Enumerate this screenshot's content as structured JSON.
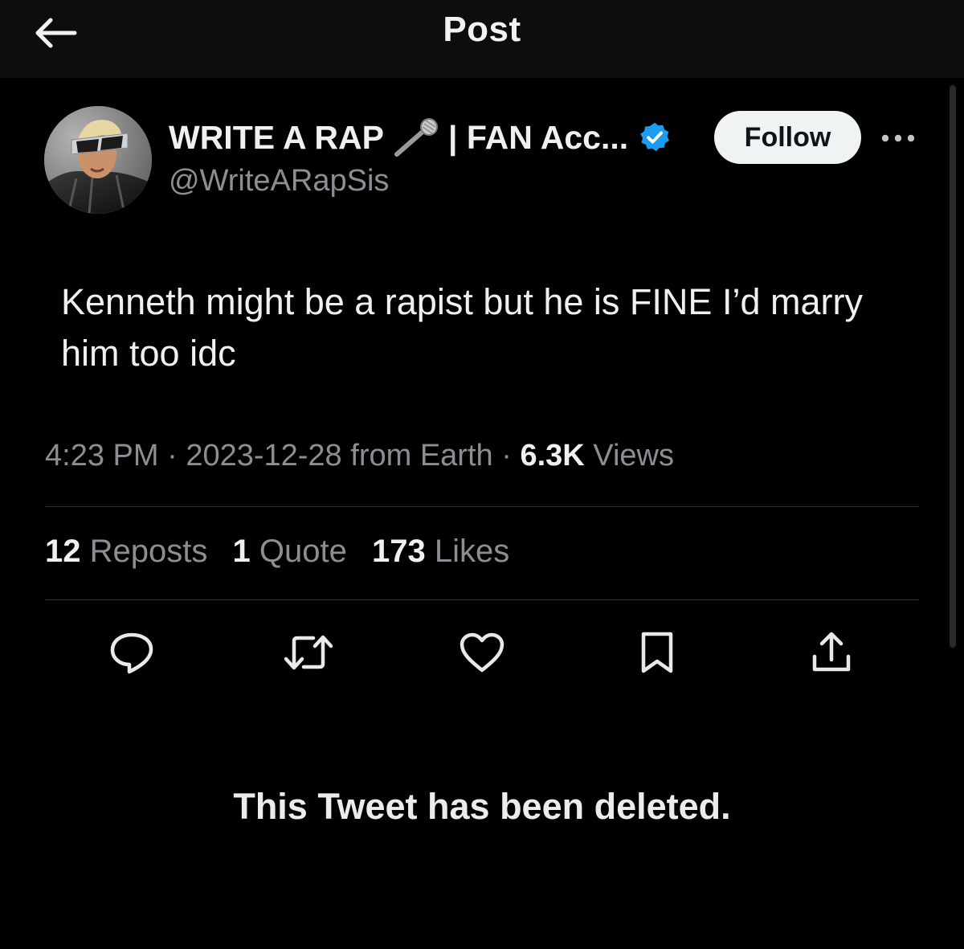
{
  "header": {
    "title": "Post",
    "back_icon": "arrow-left-icon"
  },
  "author": {
    "display_name": "WRITE A RAP",
    "display_name_suffix": "| FAN Acc...",
    "handle": "@WriteARapSis",
    "verified": true,
    "verified_color": "#1d9bf0",
    "avatar_icon": "profile-photo"
  },
  "follow_label": "Follow",
  "tweet": {
    "text": "Kenneth might be a rapist but he is FINE I’d marry him too idc"
  },
  "meta": {
    "time": "4:23 PM",
    "date": "2023-12-28",
    "source": "from Earth",
    "views_count": "6.3K",
    "views_label": "Views"
  },
  "stats": {
    "reposts_count": "12",
    "reposts_label": "Reposts",
    "quotes_count": "1",
    "quotes_label": "Quote",
    "likes_count": "173",
    "likes_label": "Likes"
  },
  "actions": {
    "reply_icon": "reply-icon",
    "repost_icon": "repost-icon",
    "like_icon": "heart-icon",
    "bookmark_icon": "bookmark-icon",
    "share_icon": "share-icon"
  },
  "notice": "This Tweet has been deleted.",
  "colors": {
    "background": "#000000",
    "header_bg": "#0d0d0d",
    "text_primary": "#f0f0f0",
    "text_secondary": "#8b8f93",
    "divider": "#2f3336",
    "follow_bg": "#eff3f4"
  }
}
